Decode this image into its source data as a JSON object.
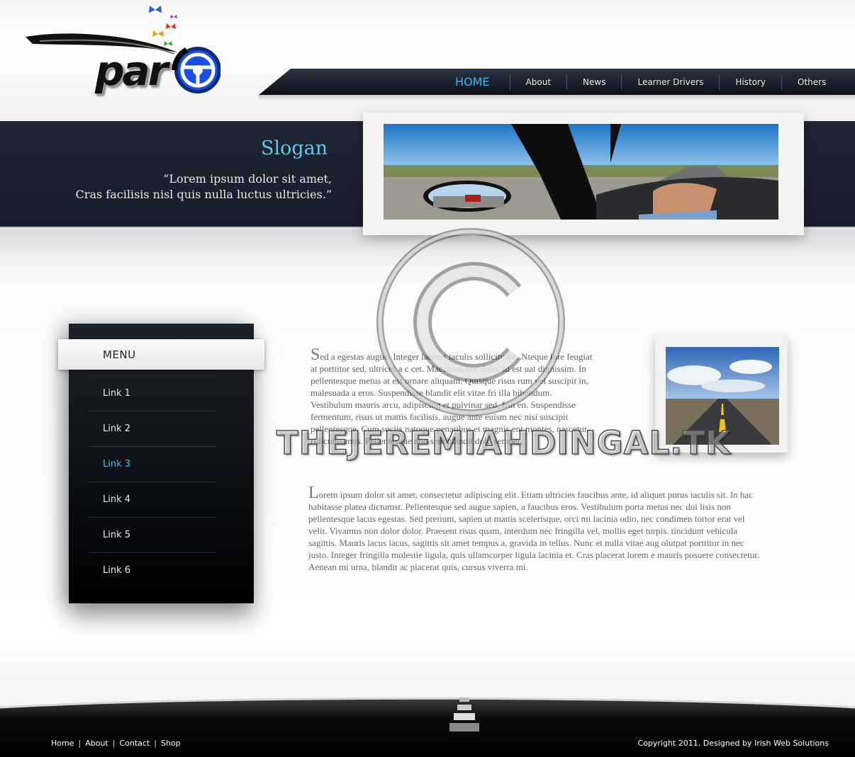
{
  "brand": {
    "logo_text": "par"
  },
  "nav": {
    "items": [
      {
        "label": "HOME",
        "active": true
      },
      {
        "label": "About"
      },
      {
        "label": "News"
      },
      {
        "label": "Learner Drivers"
      },
      {
        "label": "History"
      },
      {
        "label": "Others"
      }
    ]
  },
  "banner": {
    "slogan": "Slogan",
    "quote_line1": "“Lorem ipsum dolor sit amet,",
    "quote_line2": "Cras facilisis nisl quis nulla luctus ultricies.”"
  },
  "sidebar": {
    "menu_title": "MENU",
    "items": [
      {
        "label": "Link 1"
      },
      {
        "label": "Link 2"
      },
      {
        "label": "Link 3",
        "active": true
      },
      {
        "label": "Link 4"
      },
      {
        "label": "Link 5"
      },
      {
        "label": "Link 6"
      }
    ]
  },
  "content": {
    "para1_cap": "S",
    "para1": "ed a egestas augue. Integer laoreet iaculis sollicitudin. Nteque lore feugiat at porttitor sed, ultrices a c cet. Maecenas nec dolor id est uat dignissim. In pellentesque metus at est ornare aliquam. Quisque risus rum vel suscipit in, malesuada a eros. Suspendisse blandit elit vitae fri illa bibendum. Vestibulum mauris arcu, adipiscing et pulvinar sed, frin en. Suspendisse fermentum, risus ut mattis facilisis, augue ante euism nec nisi suscipit pellentesque. Cum sociis natoque penatibus et magnis ent montes, nascetur ridiculus mus. Pellentesque non sem blandit dolo semper.",
    "para2_cap": "L",
    "para2": "orem ipsum dolor sit amet, consectetur adipiscing elit. Etiam ultricies faucibus ante, id aliquet purus iaculis sit. In hac habitasse platea dictumst. Pellentesque sed augue sapien, a faucibus eros. Vestibulum porta metus nec dui lisis non pellentesque lacus egestas. Sed pretium, sapien ut mattis scelerisque, orci mi lacinia odio, nec condimen tortor erat vel velit. Vivamus non dolor dolor. Praesent risus quam, interdum nec fringilla vel, mollis eget turpis. tincidunt vehicula sagittis. Mauris lacus lacus, sagittis sit amet tempus a, gravida in tellus. Nunc et nulla vitae aug olutpat porttitor in nec justo. Integer fringilla molestie ligula, quis ullamcorper ligula lacinia et. Cras placerat lorem e mauris posuere consectetur. Aenean mi urna, blandit ac placerat quis, cursus viverra mi."
  },
  "watermark": {
    "text": "THEJEREMIAHDINGAL.TK"
  },
  "footer": {
    "links": [
      "Home",
      "About",
      "Contact",
      "Shop"
    ],
    "copyright": "Copyright 2011. Designed by Irish Web Solutions"
  },
  "colors": {
    "accent": "#3fb6e8",
    "dark_bg": "#1a212d"
  }
}
